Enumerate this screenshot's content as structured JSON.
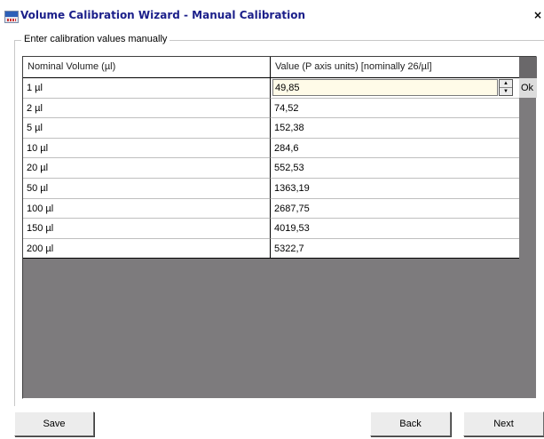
{
  "window": {
    "title": "Volume Calibration Wizard - Manual Calibration",
    "close_label": "×"
  },
  "group": {
    "label": "Enter calibration values manually"
  },
  "table": {
    "headers": [
      "Nominal Volume (µl)",
      "Value (P axis units) [nominally 26/µl]"
    ],
    "rows": [
      [
        "1 µl",
        "49,85"
      ],
      [
        "2 µl",
        "74,52"
      ],
      [
        "5 µl",
        "152,38"
      ],
      [
        "10 µl",
        "284,6"
      ],
      [
        "20 µl",
        "552,53"
      ],
      [
        "50 µl",
        "1363,19"
      ],
      [
        "100 µl",
        "2687,75"
      ],
      [
        "150 µl",
        "4019,53"
      ],
      [
        "200 µl",
        "5322,7"
      ]
    ],
    "ok_label": "Ok"
  },
  "buttons": {
    "save": "Save",
    "back": "Back",
    "next": "Next"
  }
}
